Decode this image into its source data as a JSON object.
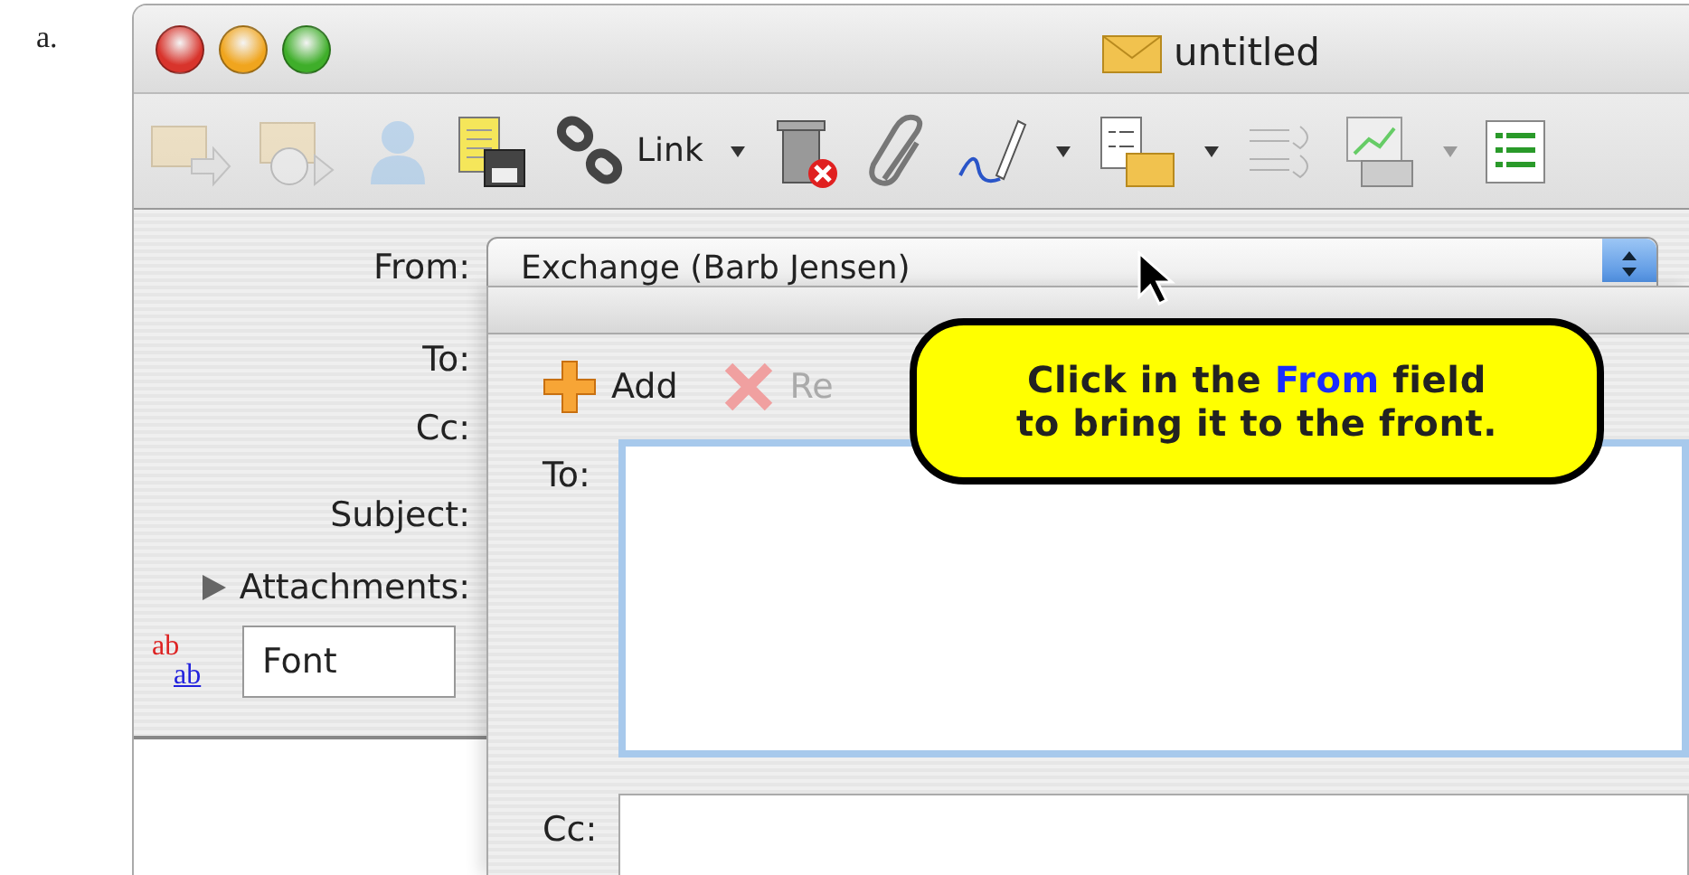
{
  "figure_label": "a.",
  "window": {
    "title": "untitled"
  },
  "toolbar": {
    "link_label": "Link"
  },
  "header": {
    "fields": [
      {
        "kind": "popup",
        "label": "From:",
        "value": "Exchange (Barb Jensen)"
      },
      {
        "kind": "text",
        "label": "To:"
      },
      {
        "kind": "text",
        "label": "Cc:"
      },
      {
        "kind": "text",
        "label": "Subject:"
      },
      {
        "kind": "disclosure",
        "label": "Attachments:",
        "expanded": false
      }
    ],
    "spelling_icon": {
      "top_text": "ab",
      "bottom_text": "ab"
    },
    "font_field": {
      "value": "Font"
    }
  },
  "address_dialog": {
    "buttons": [
      {
        "label": "Add",
        "disabled": false
      },
      {
        "label": "Re",
        "disabled": true
      }
    ],
    "fields": [
      {
        "label": "To:",
        "focused": true
      },
      {
        "label": "Cc:",
        "focused": false
      }
    ]
  },
  "callout": {
    "text": "Click in the **From** field\nto bring it to the front."
  }
}
